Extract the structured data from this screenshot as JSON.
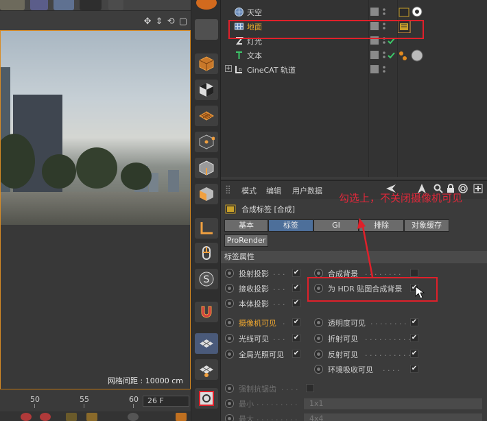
{
  "viewport": {
    "grid_spacing": "网格间距 : 10000 cm",
    "nav_icons": [
      "move-view-icon",
      "zoom-view-icon",
      "rotate-view-icon",
      "maximize-view-icon"
    ]
  },
  "timeline": {
    "ticks": [
      "50",
      "55",
      "60"
    ],
    "current_frame": "26 F"
  },
  "object_manager": {
    "objects": [
      {
        "label": "天空",
        "icon": "sky-icon",
        "selected": false,
        "indent": 1
      },
      {
        "label": "地面",
        "icon": "floor-icon",
        "selected": true,
        "indent": 1
      },
      {
        "label": "灯光",
        "icon": "light-icon",
        "selected": false,
        "indent": 1
      },
      {
        "label": "文本",
        "icon": "text-icon",
        "selected": false,
        "indent": 1
      },
      {
        "label": "CineCAT 轨道",
        "icon": "null-icon",
        "selected": false,
        "indent": 0
      }
    ]
  },
  "attribute_manager": {
    "menu": [
      "模式",
      "编辑",
      "用户数据"
    ],
    "title": "合成标签 [合成]",
    "tabs": [
      "基本",
      "标签",
      "GI",
      "排除",
      "对象缓存"
    ],
    "active_tab": "标签",
    "extra_tab": "ProRender",
    "section": "标签属性",
    "left_props": [
      {
        "label": "投射投影",
        "checked": true,
        "highlight": false
      },
      {
        "label": "接收投影",
        "checked": true,
        "highlight": false
      },
      {
        "label": "本体投影",
        "checked": true,
        "highlight": false
      },
      {
        "label": "摄像机可见",
        "checked": true,
        "highlight": true
      },
      {
        "label": "光线可见",
        "checked": true,
        "highlight": false
      },
      {
        "label": "全局光照可见",
        "checked": true,
        "highlight": false
      }
    ],
    "right_props": [
      {
        "label": "合成背景",
        "checked": false
      },
      {
        "label": "为 HDR 贴图合成背景",
        "checked": true
      },
      {
        "label": "透明度可见",
        "checked": true
      },
      {
        "label": "折射可见",
        "checked": true
      },
      {
        "label": "反射可见",
        "checked": true
      },
      {
        "label": "环境吸收可见",
        "checked": true
      }
    ],
    "dim_props": {
      "antialias_label": "强制抗锯齿",
      "min_label": "最小",
      "min_value": "1x1",
      "max_label": "最大",
      "max_value": "4x4"
    }
  },
  "annotation": {
    "text": "勾选上，不关闭摄像机可见",
    "color": "#e0202a"
  },
  "colors": {
    "accent_orange": "#d88b24",
    "tab_active": "#4d6f9a",
    "selected_text": "#f0b030",
    "annotation_red": "#e0202a"
  }
}
